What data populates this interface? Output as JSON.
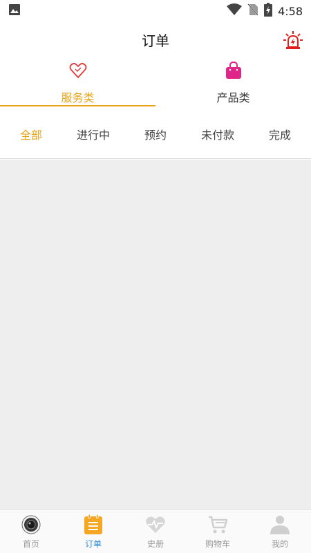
{
  "status_bar": {
    "time": "4:58",
    "icons": [
      "image-icon",
      "wifi-icon",
      "no-sim-icon",
      "battery-charging-icon"
    ]
  },
  "header": {
    "title": "订单",
    "alarm_icon": "alarm-siren-icon"
  },
  "category_tabs": [
    {
      "label": "服务类",
      "icon": "heart-icon",
      "active": true
    },
    {
      "label": "产品类",
      "icon": "shopping-bag-icon",
      "active": false
    }
  ],
  "filter_tabs": [
    {
      "label": "全部",
      "active": true
    },
    {
      "label": "进行中",
      "active": false
    },
    {
      "label": "预约",
      "active": false
    },
    {
      "label": "未付款",
      "active": false
    },
    {
      "label": "完成",
      "active": false
    }
  ],
  "bottom_nav": [
    {
      "label": "首页",
      "icon": "home-camera-icon",
      "active": false
    },
    {
      "label": "订单",
      "icon": "order-clipboard-icon",
      "active": true
    },
    {
      "label": "史册",
      "icon": "heartbeat-icon",
      "active": false
    },
    {
      "label": "购物车",
      "icon": "cart-icon",
      "active": false
    },
    {
      "label": "我的",
      "icon": "user-icon",
      "active": false
    }
  ],
  "colors": {
    "accent": "#e8a317",
    "nav_active": "#2a8ad6",
    "alarm_red": "#e02020",
    "bag_pink": "#e0258a",
    "content_bg": "#eeeeee"
  }
}
